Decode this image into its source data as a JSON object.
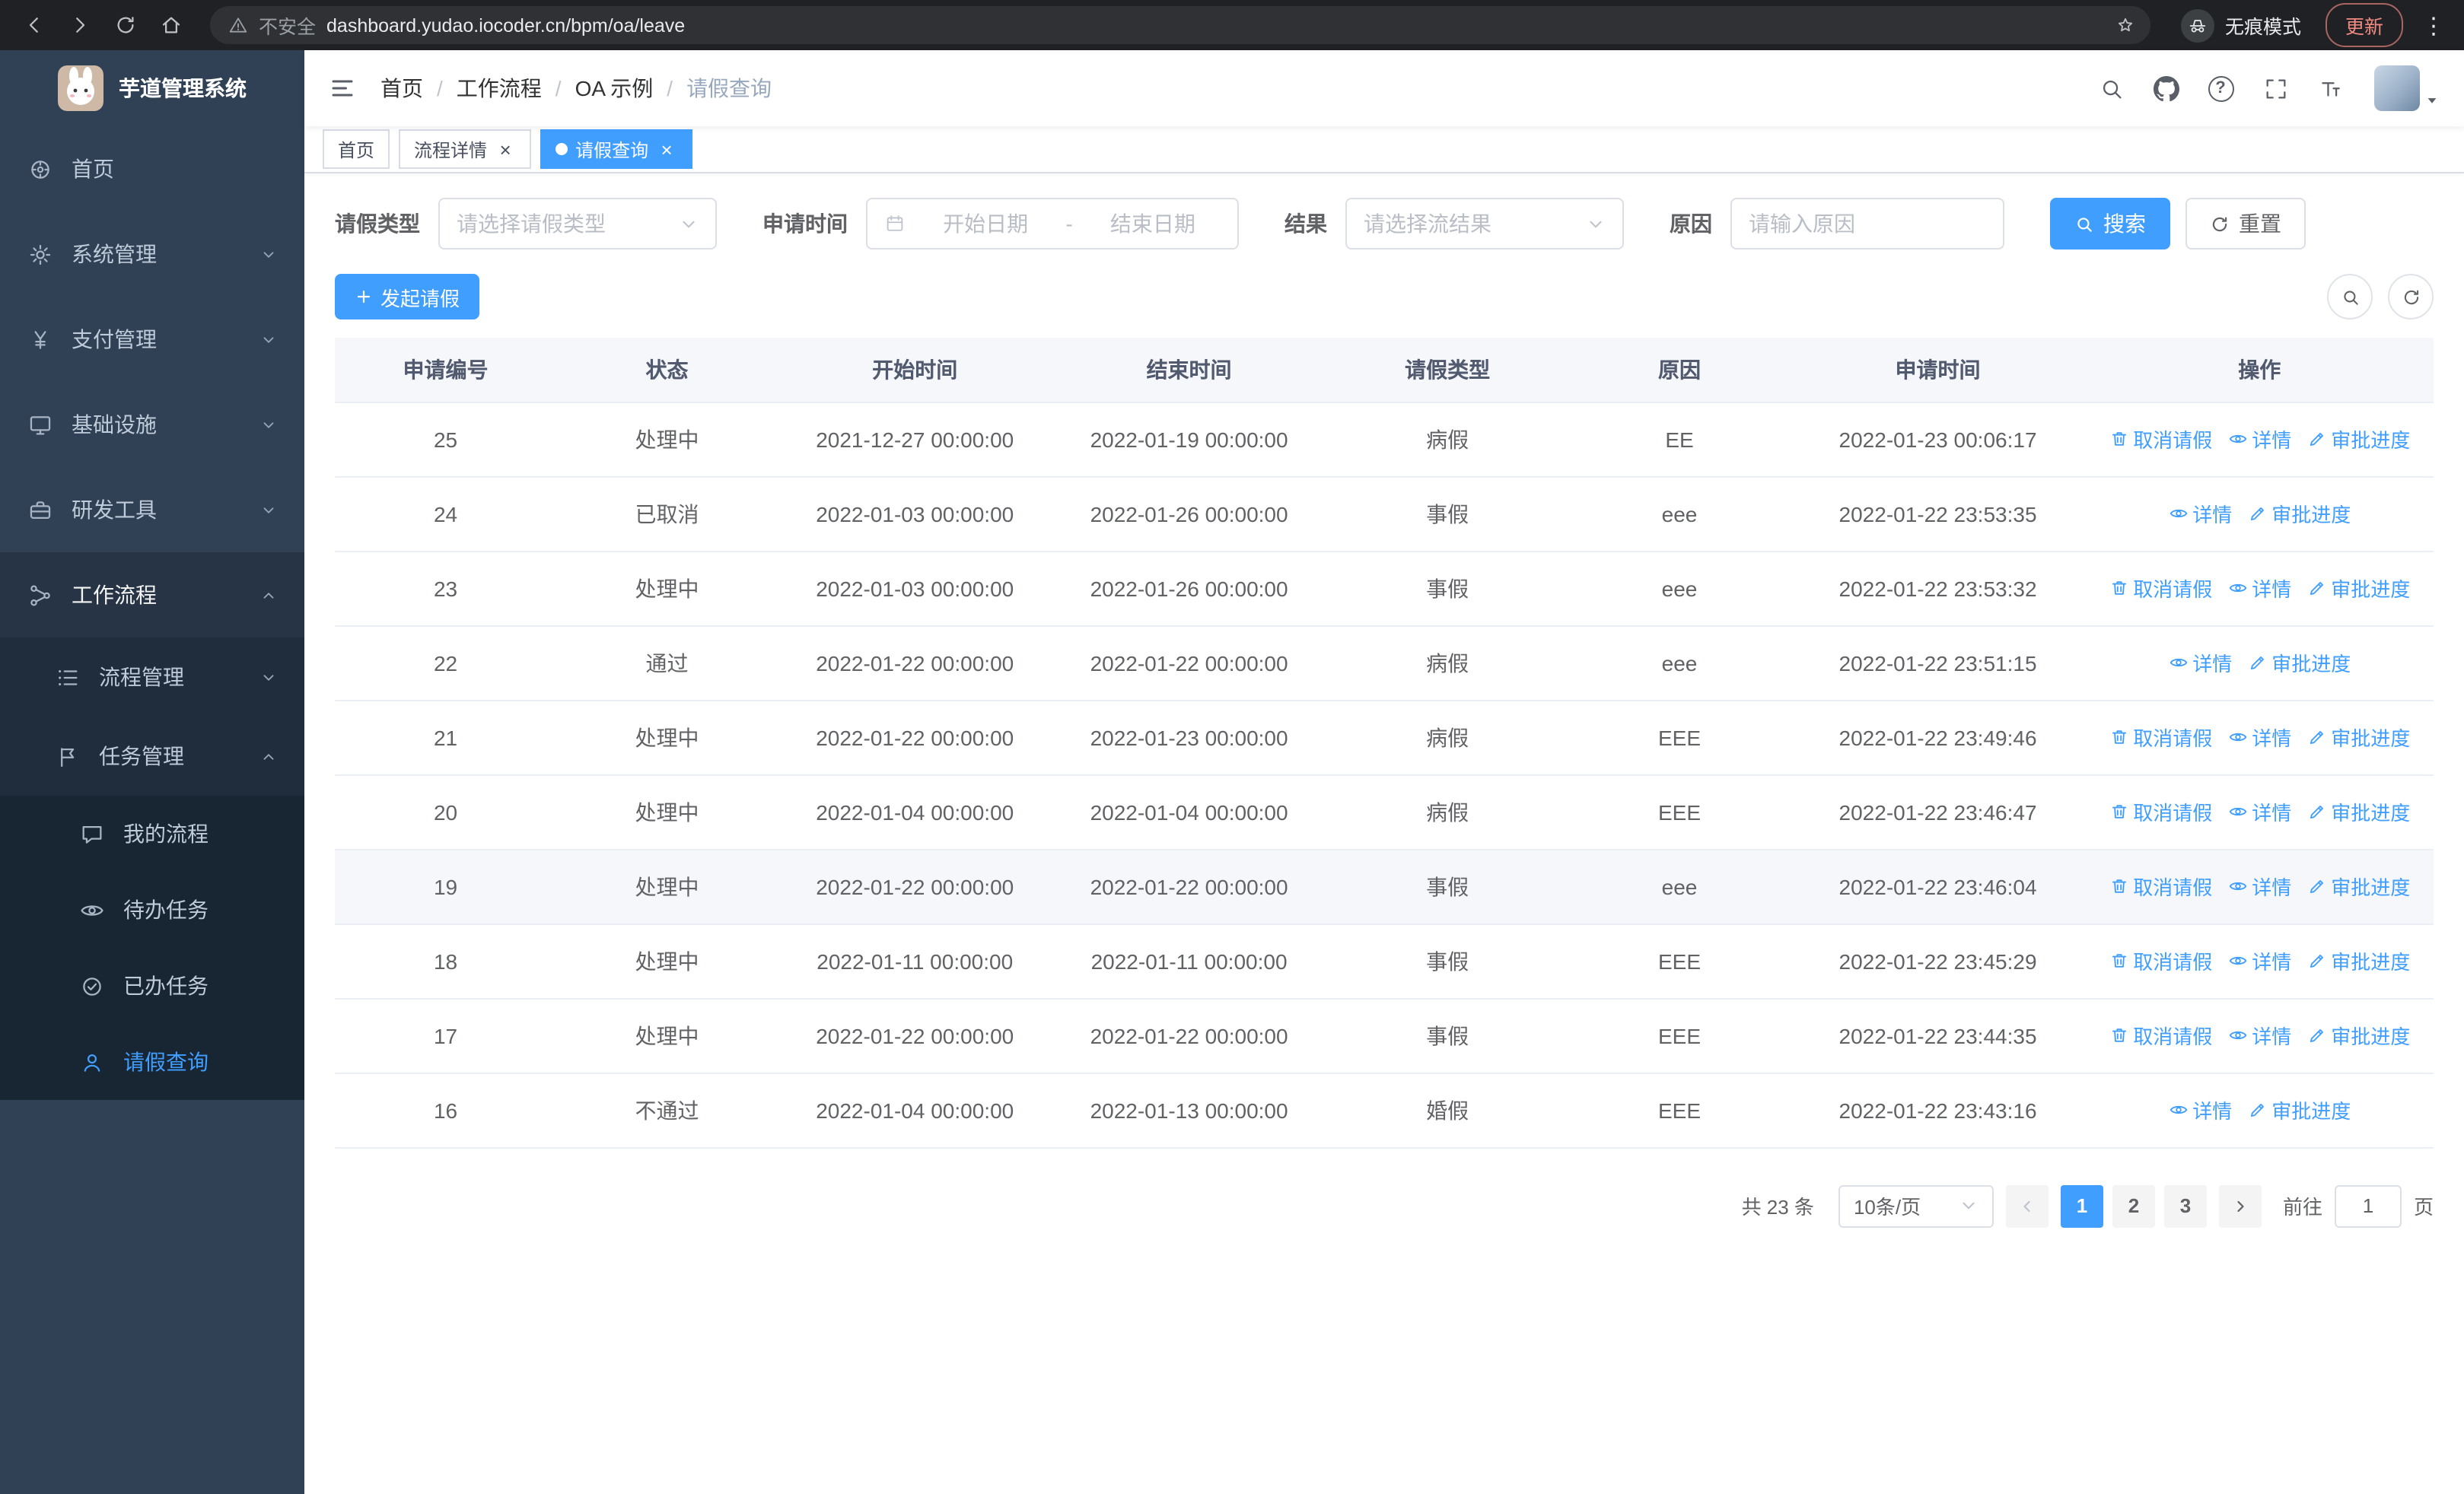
{
  "browser": {
    "security_label": "不安全",
    "url": "dashboard.yudao.iocoder.cn/bpm/oa/leave",
    "incognito_label": "无痕模式",
    "update_label": "更新"
  },
  "icons": {
    "help_glyph": "?",
    "close_glyph": "×",
    "dots_glyph": "⋮"
  },
  "colors": {
    "accent": "#409eff",
    "sidebar_bg": "#304156",
    "submenu_bg": "#1f2d3d",
    "table_header_bg": "#f5f7fa"
  },
  "sidebar": {
    "app_title": "芋道管理系统",
    "items": [
      {
        "key": "home",
        "label": "首页",
        "icon": "dashboard-icon",
        "level": 1
      },
      {
        "key": "system",
        "label": "系统管理",
        "icon": "gear-icon",
        "level": 1,
        "arrow": "down"
      },
      {
        "key": "payment",
        "label": "支付管理",
        "icon": "yen-icon",
        "level": 1,
        "arrow": "down"
      },
      {
        "key": "infra",
        "label": "基础设施",
        "icon": "monitor-icon",
        "level": 1,
        "arrow": "down"
      },
      {
        "key": "devtools",
        "label": "研发工具",
        "icon": "toolbox-icon",
        "level": 1,
        "arrow": "down"
      },
      {
        "key": "workflow",
        "label": "工作流程",
        "icon": "workflow-icon",
        "level": 1,
        "arrow": "up",
        "open": true
      },
      {
        "key": "process-mgmt",
        "label": "流程管理",
        "icon": "list-icon",
        "level": 2,
        "arrow": "down"
      },
      {
        "key": "task-mgmt",
        "label": "任务管理",
        "icon": "flag-icon",
        "level": 2,
        "arrow": "up",
        "open": true
      },
      {
        "key": "my-process",
        "label": "我的流程",
        "icon": "chat-icon",
        "level": 3
      },
      {
        "key": "todo-tasks",
        "label": "待办任务",
        "icon": "eye-icon",
        "level": 3
      },
      {
        "key": "done-tasks",
        "label": "已办任务",
        "icon": "done-icon",
        "level": 3
      },
      {
        "key": "leave-query",
        "label": "请假查询",
        "icon": "user-icon",
        "level": 3,
        "active": true
      }
    ]
  },
  "header": {
    "breadcrumb": [
      "首页",
      "工作流程",
      "OA 示例",
      "请假查询"
    ]
  },
  "tabs": [
    {
      "key": "home",
      "label": "首页",
      "closable": false,
      "active": false
    },
    {
      "key": "process-detail",
      "label": "流程详情",
      "closable": true,
      "active": false
    },
    {
      "key": "leave-query",
      "label": "请假查询",
      "closable": true,
      "active": true
    }
  ],
  "filters": {
    "leave_type": {
      "label": "请假类型",
      "placeholder": "请选择请假类型"
    },
    "apply_time": {
      "label": "申请时间",
      "start_placeholder": "开始日期",
      "separator": "-",
      "end_placeholder": "结束日期"
    },
    "result": {
      "label": "结果",
      "placeholder": "请选择流结果"
    },
    "reason": {
      "label": "原因",
      "placeholder": "请输入原因"
    },
    "search_label": "搜索",
    "reset_label": "重置"
  },
  "toolbar": {
    "create_label": "发起请假"
  },
  "table": {
    "columns": [
      "申请编号",
      "状态",
      "开始时间",
      "结束时间",
      "请假类型",
      "原因",
      "申请时间",
      "操作"
    ],
    "actions": {
      "cancel": "取消请假",
      "detail": "详情",
      "progress": "审批进度"
    },
    "rows": [
      {
        "id": "25",
        "status": "处理中",
        "start": "2021-12-27 00:00:00",
        "end": "2022-01-19 00:00:00",
        "type": "病假",
        "reason": "EE",
        "applied": "2022-01-23 00:06:17",
        "actions": [
          "cancel",
          "detail",
          "progress"
        ],
        "hover": false
      },
      {
        "id": "24",
        "status": "已取消",
        "start": "2022-01-03 00:00:00",
        "end": "2022-01-26 00:00:00",
        "type": "事假",
        "reason": "eee",
        "applied": "2022-01-22 23:53:35",
        "actions": [
          "detail",
          "progress"
        ],
        "hover": false
      },
      {
        "id": "23",
        "status": "处理中",
        "start": "2022-01-03 00:00:00",
        "end": "2022-01-26 00:00:00",
        "type": "事假",
        "reason": "eee",
        "applied": "2022-01-22 23:53:32",
        "actions": [
          "cancel",
          "detail",
          "progress"
        ],
        "hover": false
      },
      {
        "id": "22",
        "status": "通过",
        "start": "2022-01-22 00:00:00",
        "end": "2022-01-22 00:00:00",
        "type": "病假",
        "reason": "eee",
        "applied": "2022-01-22 23:51:15",
        "actions": [
          "detail",
          "progress"
        ],
        "hover": false
      },
      {
        "id": "21",
        "status": "处理中",
        "start": "2022-01-22 00:00:00",
        "end": "2022-01-23 00:00:00",
        "type": "病假",
        "reason": "EEE",
        "applied": "2022-01-22 23:49:46",
        "actions": [
          "cancel",
          "detail",
          "progress"
        ],
        "hover": false
      },
      {
        "id": "20",
        "status": "处理中",
        "start": "2022-01-04 00:00:00",
        "end": "2022-01-04 00:00:00",
        "type": "病假",
        "reason": "EEE",
        "applied": "2022-01-22 23:46:47",
        "actions": [
          "cancel",
          "detail",
          "progress"
        ],
        "hover": false
      },
      {
        "id": "19",
        "status": "处理中",
        "start": "2022-01-22 00:00:00",
        "end": "2022-01-22 00:00:00",
        "type": "事假",
        "reason": "eee",
        "applied": "2022-01-22 23:46:04",
        "actions": [
          "cancel",
          "detail",
          "progress"
        ],
        "hover": true
      },
      {
        "id": "18",
        "status": "处理中",
        "start": "2022-01-11 00:00:00",
        "end": "2022-01-11 00:00:00",
        "type": "事假",
        "reason": "EEE",
        "applied": "2022-01-22 23:45:29",
        "actions": [
          "cancel",
          "detail",
          "progress"
        ],
        "hover": false
      },
      {
        "id": "17",
        "status": "处理中",
        "start": "2022-01-22 00:00:00",
        "end": "2022-01-22 00:00:00",
        "type": "事假",
        "reason": "EEE",
        "applied": "2022-01-22 23:44:35",
        "actions": [
          "cancel",
          "detail",
          "progress"
        ],
        "hover": false
      },
      {
        "id": "16",
        "status": "不通过",
        "start": "2022-01-04 00:00:00",
        "end": "2022-01-13 00:00:00",
        "type": "婚假",
        "reason": "EEE",
        "applied": "2022-01-22 23:43:16",
        "actions": [
          "detail",
          "progress"
        ],
        "hover": false
      }
    ]
  },
  "pagination": {
    "total_label": "共 23 条",
    "page_size": "10条/页",
    "pages": [
      "1",
      "2",
      "3"
    ],
    "active_page": "1",
    "goto_label": "前往",
    "goto_value": "1",
    "unit_label": "页"
  }
}
